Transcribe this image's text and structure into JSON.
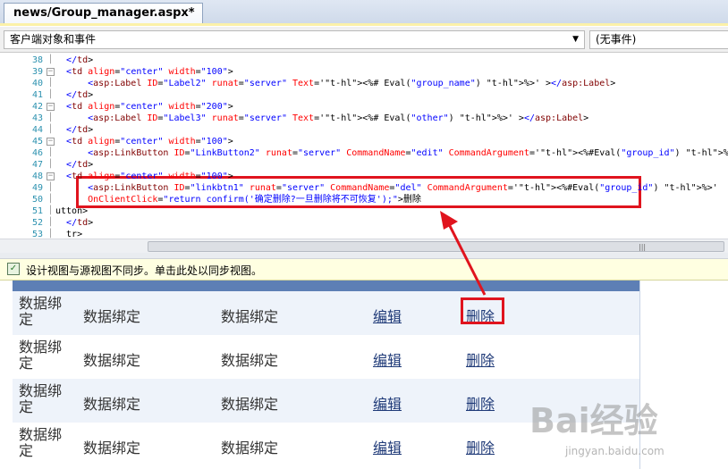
{
  "tab": {
    "title": "news/Group_manager.aspx*"
  },
  "objbar": {
    "left_value": "客户端对象和事件",
    "right_value": "(无事件)"
  },
  "code": {
    "lines": [
      {
        "num": "38",
        "text": "  </td>"
      },
      {
        "num": "39",
        "text": "  <td align=\"center\" width=\"100\">"
      },
      {
        "num": "40",
        "text": "      <asp:Label ID=\"Label2\" runat=\"server\" Text='<%# Eval(\"group_name\") %>' ></asp:Label>"
      },
      {
        "num": "41",
        "text": "  </td>"
      },
      {
        "num": "42",
        "text": "  <td align=\"center\" width=\"200\">"
      },
      {
        "num": "43",
        "text": "      <asp:Label ID=\"Label3\" runat=\"server\" Text='<%# Eval(\"other\") %>' ></asp:Label>"
      },
      {
        "num": "44",
        "text": "  </td>"
      },
      {
        "num": "45",
        "text": "  <td align=\"center\" width=\"100\">"
      },
      {
        "num": "46",
        "text": "      <asp:LinkButton ID=\"LinkButton2\" runat=\"server\" CommandName=\"edit\" CommandArgument='<%#Eval(\"group_id\") %>' >编辑</asp:Li"
      },
      {
        "num": "47",
        "text": "  </td>"
      },
      {
        "num": "48",
        "text": "  <td align=\"center\" width=\"100\">"
      },
      {
        "num": "49",
        "text": "      <asp:LinkButton ID=\"linkbtn1\" runat=\"server\" CommandName=\"del\" CommandArgument='<%#Eval(\"group_id\") %>'"
      },
      {
        "num": "50",
        "text": "      OnClientClick=\"return confirm('确定删除?一旦删除将不可恢复');\">删除"
      },
      {
        "num": "51",
        "text": "utton>"
      },
      {
        "num": "52",
        "text": "  </td>"
      },
      {
        "num": "53",
        "text": "  tr>"
      }
    ]
  },
  "infobar": {
    "message": "设计视图与源视图不同步。单击此处以同步视图。"
  },
  "grid": {
    "rows": [
      {
        "c1": "数据绑定",
        "c2": "数据绑定",
        "c3": "数据绑定",
        "edit": "编辑",
        "del": "删除"
      },
      {
        "c1": "数据绑定",
        "c2": "数据绑定",
        "c3": "数据绑定",
        "edit": "编辑",
        "del": "删除"
      },
      {
        "c1": "数据绑定",
        "c2": "数据绑定",
        "c3": "数据绑定",
        "edit": "编辑",
        "del": "删除"
      },
      {
        "c1": "数据绑定",
        "c2": "数据绑定",
        "c3": "数据绑定",
        "edit": "编辑",
        "del": "删除"
      }
    ]
  },
  "watermark": {
    "logo": "Bai经验",
    "url": "jingyan.baidu.com"
  },
  "colors": {
    "highlight_box": "#e0141e",
    "grid_header": "#5d7fb5"
  }
}
